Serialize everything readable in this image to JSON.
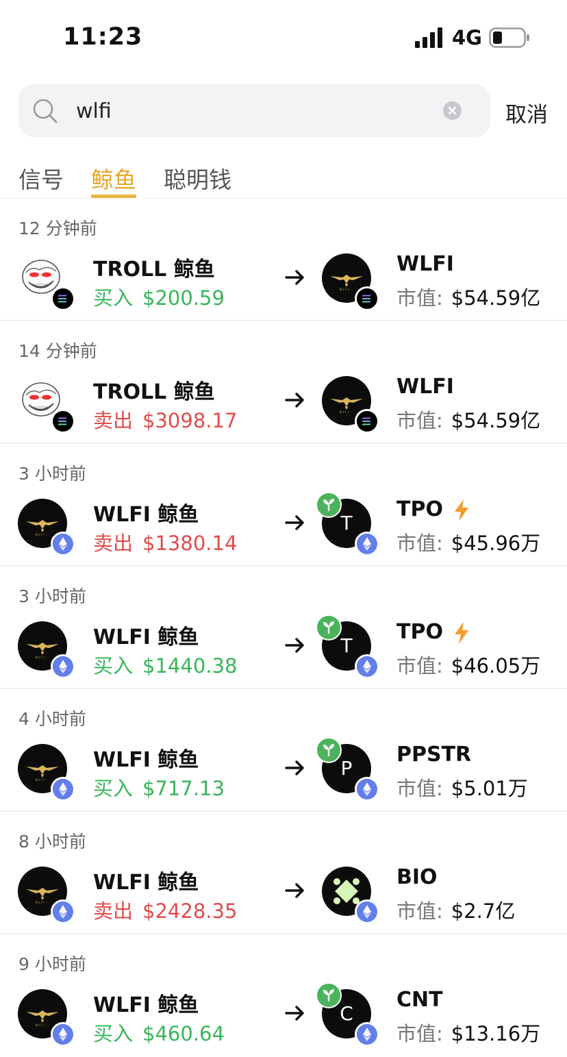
{
  "status_bar": {
    "time": "11:23",
    "network": "4G"
  },
  "search": {
    "query": "wlfi",
    "cancel_label": "取消"
  },
  "tabs": [
    {
      "label": "信号",
      "active": false
    },
    {
      "label": "鲸鱼",
      "active": true
    },
    {
      "label": "聪明钱",
      "active": false
    }
  ],
  "colors": {
    "accent": "#e6a92c",
    "buy": "#39b55a",
    "sell": "#e04c4c"
  },
  "market_cap_label": "市值:",
  "feed": [
    {
      "time": "12 分钟前",
      "whale": "TROLL 鲸鱼",
      "whale_icon": "troll-face",
      "whale_chain": "solana",
      "action": "买入",
      "amount": "$200.59",
      "side": "buy",
      "token": "WLFI",
      "token_icon": "eagle-logo",
      "token_chain": "solana",
      "new": false,
      "bolt": false,
      "market_cap": "$54.59亿"
    },
    {
      "time": "14 分钟前",
      "whale": "TROLL 鲸鱼",
      "whale_icon": "troll-face",
      "whale_chain": "solana",
      "action": "卖出",
      "amount": "$3098.17",
      "side": "sell",
      "token": "WLFI",
      "token_icon": "eagle-logo",
      "token_chain": "solana",
      "new": false,
      "bolt": false,
      "market_cap": "$54.59亿"
    },
    {
      "time": "3 小时前",
      "whale": "WLFI 鲸鱼",
      "whale_icon": "eagle-logo",
      "whale_chain": "ethereum",
      "action": "卖出",
      "amount": "$1380.14",
      "side": "sell",
      "token": "TPO",
      "token_icon": "letter",
      "token_letter": "T",
      "token_chain": "ethereum",
      "new": true,
      "bolt": true,
      "market_cap": "$45.96万"
    },
    {
      "time": "3 小时前",
      "whale": "WLFI 鲸鱼",
      "whale_icon": "eagle-logo",
      "whale_chain": "ethereum",
      "action": "买入",
      "amount": "$1440.38",
      "side": "buy",
      "token": "TPO",
      "token_icon": "letter",
      "token_letter": "T",
      "token_chain": "ethereum",
      "new": true,
      "bolt": true,
      "market_cap": "$46.05万"
    },
    {
      "time": "4 小时前",
      "whale": "WLFI 鲸鱼",
      "whale_icon": "eagle-logo",
      "whale_chain": "ethereum",
      "action": "买入",
      "amount": "$717.13",
      "side": "buy",
      "token": "PPSTR",
      "token_icon": "letter",
      "token_letter": "P",
      "token_chain": "ethereum",
      "new": true,
      "bolt": false,
      "market_cap": "$5.01万"
    },
    {
      "time": "8 小时前",
      "whale": "WLFI 鲸鱼",
      "whale_icon": "eagle-logo",
      "whale_chain": "ethereum",
      "action": "卖出",
      "amount": "$2428.35",
      "side": "sell",
      "token": "BIO",
      "token_icon": "bio-logo",
      "token_chain": "ethereum",
      "new": false,
      "bolt": false,
      "market_cap": "$2.7亿"
    },
    {
      "time": "9 小时前",
      "whale": "WLFI 鲸鱼",
      "whale_icon": "eagle-logo",
      "whale_chain": "ethereum",
      "action": "买入",
      "amount": "$460.64",
      "side": "buy",
      "token": "CNT",
      "token_icon": "letter",
      "token_letter": "C",
      "token_chain": "ethereum",
      "new": true,
      "bolt": false,
      "market_cap": "$13.16万"
    }
  ]
}
